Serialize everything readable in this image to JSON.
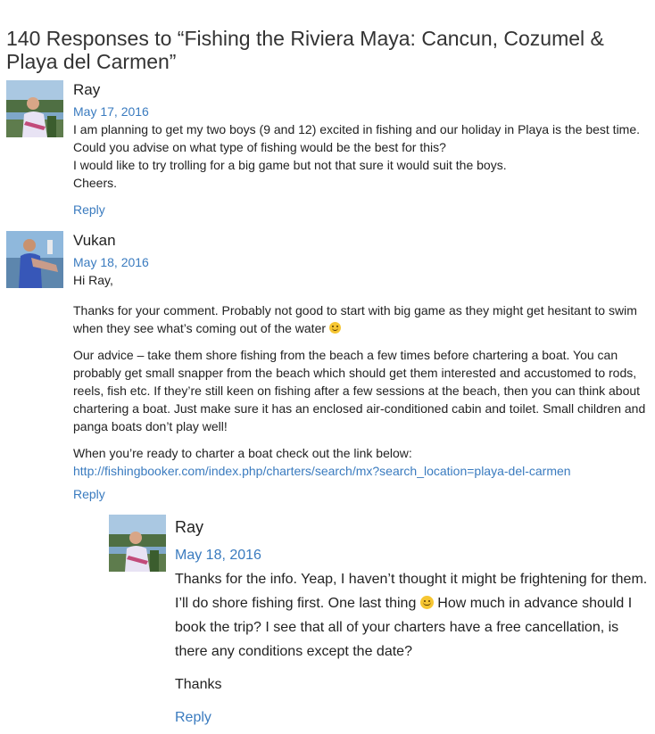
{
  "heading": "140 Responses to “Fishing the Riviera Maya: Cancun, Cozumel & Playa del Carmen”",
  "comments": [
    {
      "author": "Ray",
      "date": "May 17, 2016",
      "lines": [
        "I am planning to get my two boys (9 and 12) excited in fishing and our holiday in Playa is the best time. Could you advise on what type of fishing would be the best for this?",
        "I would like to try trolling for a big game but not that sure it would suit the boys.",
        "Cheers."
      ],
      "reply": "Reply",
      "avatar_icon": "user-photo-avatar"
    },
    {
      "author": "Vukan",
      "date": "May 18, 2016",
      "greeting": "Hi Ray,",
      "p1": "Thanks for your comment. Probably not good to start with big game as they might get hesitant to swim when they see what’s coming out of the water",
      "p2": "Our advice – take them shore fishing from the beach a few times before chartering a boat. You can probably get small snapper from the beach which should get them interested and accustomed to rods, reels, fish etc. If they’re still keen on fishing after a few sessions at the beach, then you can think about chartering a boat. Just make sure it has an enclosed air-conditioned cabin and toilet. Small children and panga boats don’t play well!",
      "p3": "When you’re ready to charter a boat check out the link below:",
      "link": "http://fishingbooker.com/index.php/charters/search/mx?search_location=playa-del-carmen",
      "reply": "Reply",
      "avatar_icon": "user-photo-avatar"
    },
    {
      "author": "Ray",
      "date": "May 18, 2016",
      "p1a": "Thanks for the info. Yeap, I haven’t thought it might be frightening for them. I’ll do shore fishing first. One last thing",
      "p1b": "How much in advance should I book the trip? I see that all of your charters have a free cancellation, is there any conditions except the date?",
      "p2": "Thanks",
      "reply": "Reply",
      "avatar_icon": "user-photo-avatar"
    }
  ],
  "colors": {
    "link": "#3a7bbf",
    "text": "#222222"
  },
  "emoji_icon": "smiley-emoji-icon"
}
